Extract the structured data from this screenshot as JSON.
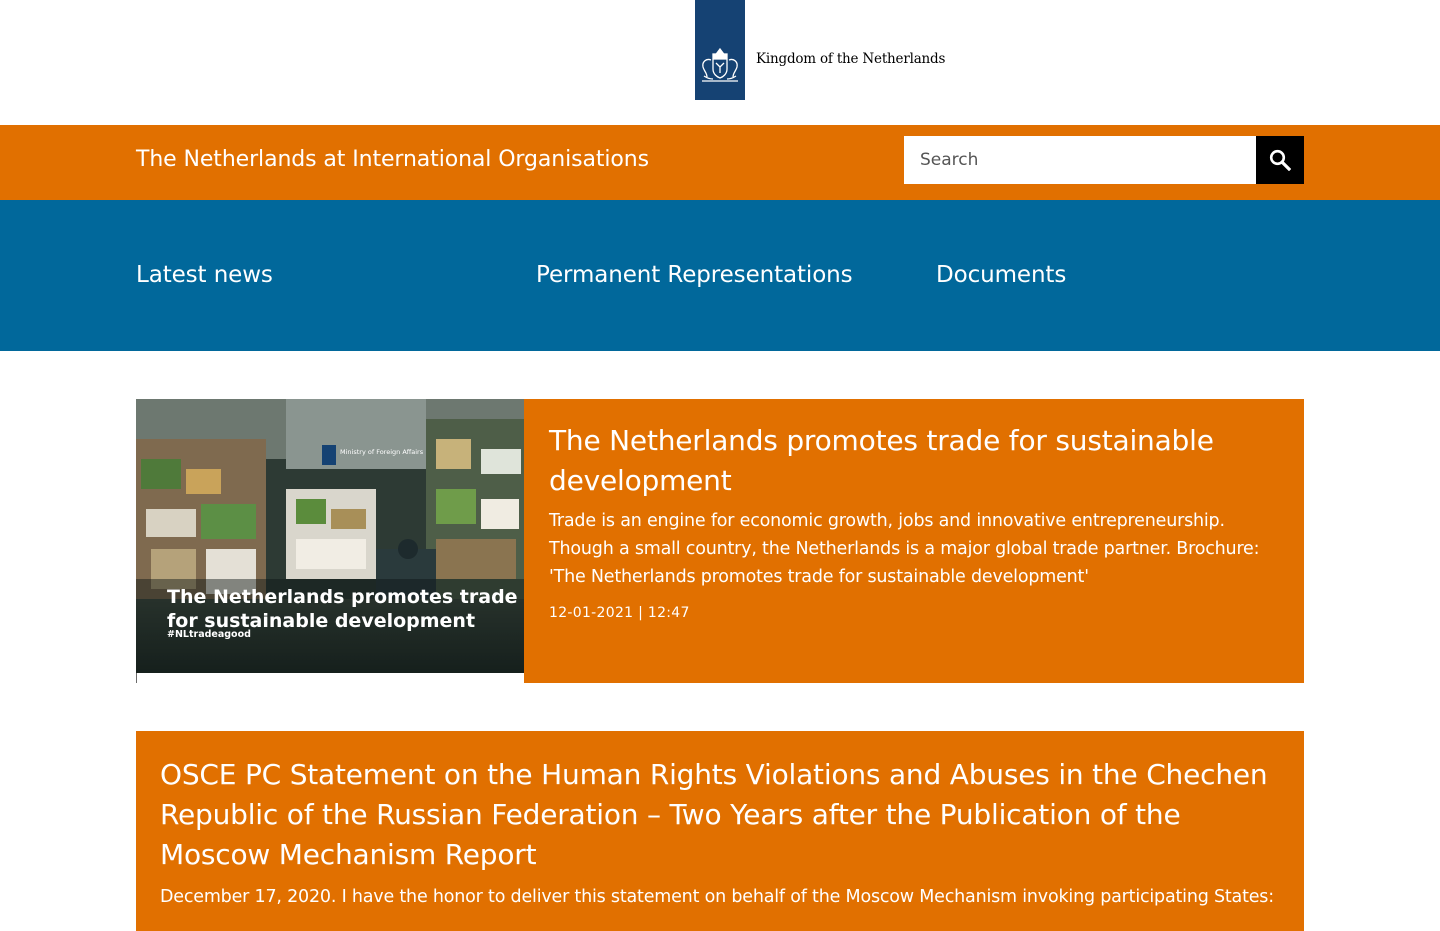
{
  "branding": {
    "wordmark": "Kingdom of the Netherlands",
    "logo_icon": "coat-of-arms-icon",
    "logo_color": "#154273"
  },
  "header": {
    "site_title": "The Netherlands at International Organisations",
    "search_placeholder": "Search",
    "search_icon": "search-icon",
    "background_color": "#e17000"
  },
  "nav": {
    "background_color": "#01689b",
    "items": [
      {
        "label": "Latest news"
      },
      {
        "label": "Permanent Representations"
      },
      {
        "label": "Documents"
      }
    ]
  },
  "featured": {
    "image_caption": "The Netherlands promotes trade for sustainable development",
    "image_hashtag": "#NLtradeagood",
    "image_ministry": "Ministry of Foreign Affairs",
    "title": "The Netherlands promotes trade for sustainable development",
    "summary": "Trade is an engine for economic growth, jobs and innovative entrepreneurship. Though a small country, the Netherlands is a major global trade partner. Brochure: 'The Netherlands promotes trade for sustainable development'",
    "date": "12-01-2021 | 12:47"
  },
  "second": {
    "title": "OSCE PC Statement on the Human Rights Violations and Abuses in the Chechen Republic of the Russian Federation – Two Years after the Publication of the Moscow Mechanism Report",
    "summary": "December 17, 2020. I have the honor to deliver this statement on behalf of the Moscow Mechanism invoking participating States:"
  }
}
